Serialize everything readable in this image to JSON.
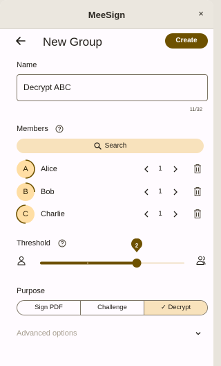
{
  "window": {
    "title": "MeeSign",
    "close_glyph": "×"
  },
  "appbar": {
    "back_icon": "arrow-left-icon",
    "title": "New Group",
    "create_label": "Create"
  },
  "name": {
    "label": "Name",
    "value": "Decrypt ABC",
    "counter": "11/32"
  },
  "members": {
    "label": "Members",
    "help_icon": "help-circle-icon",
    "search_label": "Search",
    "items": [
      {
        "initial": "A",
        "name": "Alice",
        "count": "1"
      },
      {
        "initial": "B",
        "name": "Bob",
        "count": "1"
      },
      {
        "initial": "C",
        "name": "Charlie",
        "count": "1"
      }
    ]
  },
  "threshold": {
    "label": "Threshold",
    "value": "2",
    "fraction": 0.67
  },
  "purpose": {
    "label": "Purpose",
    "options": [
      "Sign PDF",
      "Challenge",
      "Decrypt"
    ],
    "selected": "Decrypt",
    "check_glyph": "✓"
  },
  "advanced": {
    "label": "Advanced options"
  },
  "colors": {
    "primary": "#6e5100",
    "secondary_container": "#f8e2bc",
    "avatar_bg": "#ffdea4"
  }
}
